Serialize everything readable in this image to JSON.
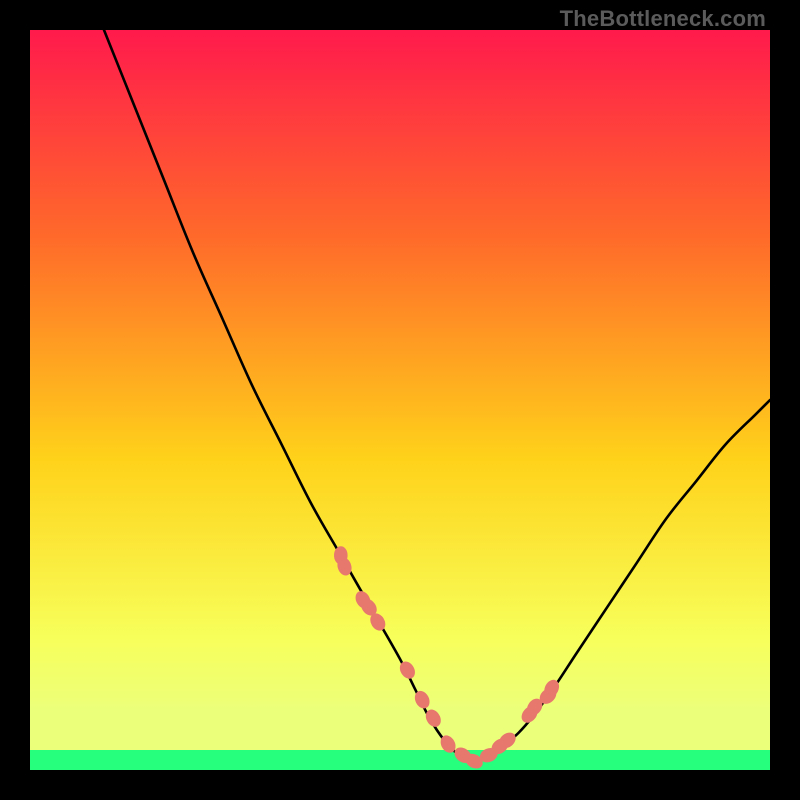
{
  "watermark": "TheBottleneck.com",
  "colors": {
    "bg": "#000000",
    "grad_top": "#ff1a4c",
    "grad_mid1": "#ff6a2a",
    "grad_mid2": "#ffd21a",
    "grad_low": "#f7ff5a",
    "grad_band": "#ecff7a",
    "grad_bottom": "#26ff7e",
    "curve": "#000000",
    "dot": "#e7786e",
    "watermark": "#5b5b5b"
  },
  "chart_data": {
    "type": "line",
    "title": "",
    "xlabel": "",
    "ylabel": "",
    "xlim": [
      0,
      100
    ],
    "ylim": [
      0,
      100
    ],
    "grid": false,
    "legend": false,
    "series": [
      {
        "name": "bottleneck-curve",
        "x": [
          10,
          14,
          18,
          22,
          26,
          30,
          34,
          38,
          42,
          46,
          50,
          52,
          54,
          56,
          58,
          60,
          62,
          66,
          70,
          74,
          78,
          82,
          86,
          90,
          94,
          98,
          100
        ],
        "y": [
          100,
          90,
          80,
          70,
          61,
          52,
          44,
          36,
          29,
          22,
          15,
          11,
          7,
          4,
          2,
          1,
          2,
          5,
          10,
          16,
          22,
          28,
          34,
          39,
          44,
          48,
          50
        ]
      }
    ],
    "highlight_points": {
      "name": "highlight-dots",
      "x": [
        42,
        42.5,
        45,
        45.8,
        47,
        51,
        53,
        54.5,
        56.5,
        58.5,
        60,
        62,
        63.5,
        64.5,
        67.5,
        68.2,
        70,
        70.5
      ],
      "y": [
        29,
        27.5,
        23,
        22,
        20,
        13.5,
        9.5,
        7,
        3.5,
        2,
        1.2,
        2,
        3.2,
        4,
        7.5,
        8.5,
        10,
        11
      ]
    },
    "green_band_y_fraction": 0.027
  }
}
